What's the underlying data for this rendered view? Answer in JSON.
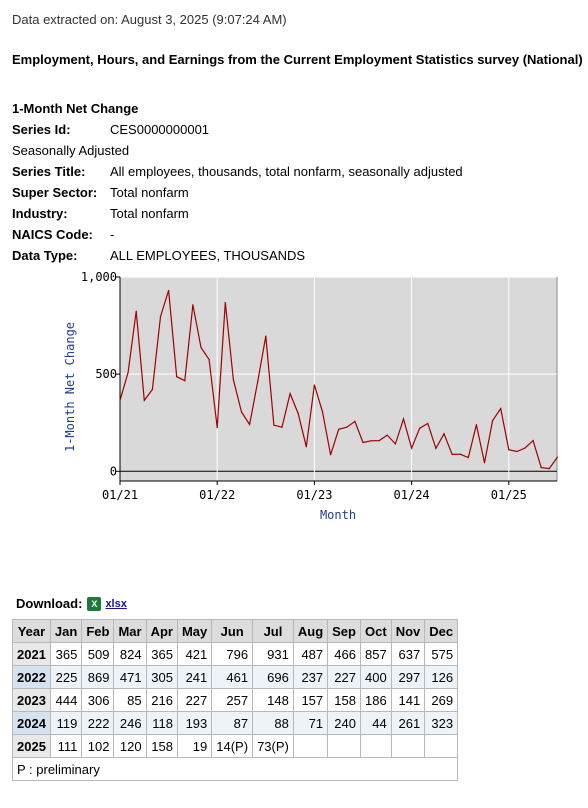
{
  "extracted_on": "Data extracted on: August 3, 2025 (9:07:24 AM)",
  "survey_title": "Employment, Hours, and Earnings from the Current Employment Statistics survey (National)",
  "section_title": "1-Month Net Change",
  "series": {
    "id_label": "Series Id:",
    "id": "CES0000000001",
    "adjustment": "Seasonally Adjusted",
    "title_label": "Series Title:",
    "title": "All employees, thousands, total nonfarm, seasonally adjusted",
    "super_sector_label": "Super Sector:",
    "super_sector": "Total nonfarm",
    "industry_label": "Industry:",
    "industry": "Total nonfarm",
    "naics_label": "NAICS Code:",
    "naics": "-",
    "data_type_label": "Data Type:",
    "data_type": "ALL EMPLOYEES, THOUSANDS"
  },
  "download": {
    "label": "Download:",
    "icon": "excel-icon",
    "link": "xlsx"
  },
  "table": {
    "columns": [
      "Year",
      "Jan",
      "Feb",
      "Mar",
      "Apr",
      "May",
      "Jun",
      "Jul",
      "Aug",
      "Sep",
      "Oct",
      "Nov",
      "Dec"
    ],
    "rows": [
      {
        "year": "2021",
        "values": [
          "365",
          "509",
          "824",
          "365",
          "421",
          "796",
          "931",
          "487",
          "466",
          "857",
          "637",
          "575"
        ]
      },
      {
        "year": "2022",
        "values": [
          "225",
          "869",
          "471",
          "305",
          "241",
          "461",
          "696",
          "237",
          "227",
          "400",
          "297",
          "126"
        ]
      },
      {
        "year": "2023",
        "values": [
          "444",
          "306",
          "85",
          "216",
          "227",
          "257",
          "148",
          "157",
          "158",
          "186",
          "141",
          "269"
        ]
      },
      {
        "year": "2024",
        "values": [
          "119",
          "222",
          "246",
          "118",
          "193",
          "87",
          "88",
          "71",
          "240",
          "44",
          "261",
          "323"
        ]
      },
      {
        "year": "2025",
        "values": [
          "111",
          "102",
          "120",
          "158",
          "19",
          "14(P)",
          "73(P)",
          "",
          "",
          "",
          "",
          ""
        ]
      }
    ],
    "footnote": "P : preliminary"
  },
  "chart_data": {
    "type": "line",
    "xlabel": "Month",
    "ylabel": "1-Month Net Change",
    "ylim": [
      -50,
      1000
    ],
    "yticks": [
      "0",
      "500",
      "1,000"
    ],
    "xticks": [
      "01/21",
      "01/22",
      "01/23",
      "01/24",
      "01/25"
    ],
    "grid": true,
    "line_color": "#a00000",
    "plot_background": "#d9d9d9",
    "x_start": "2021-01",
    "values": [
      365,
      509,
      824,
      365,
      421,
      796,
      931,
      487,
      466,
      857,
      637,
      575,
      225,
      869,
      471,
      305,
      241,
      461,
      696,
      237,
      227,
      400,
      297,
      126,
      444,
      306,
      85,
      216,
      227,
      257,
      148,
      157,
      158,
      186,
      141,
      269,
      119,
      222,
      246,
      118,
      193,
      87,
      88,
      71,
      240,
      44,
      261,
      323,
      111,
      102,
      120,
      158,
      19,
      14,
      73
    ]
  }
}
